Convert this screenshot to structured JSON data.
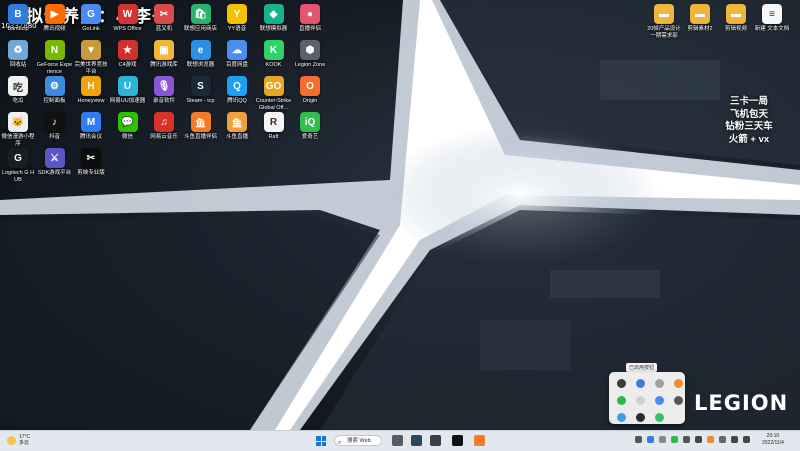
{
  "overlay": {
    "title": "模拟饲养员：小李子",
    "id": "10337880"
  },
  "desktop_icons": [
    {
      "key": "bandizip",
      "label": "Bandizip",
      "glyph": "B",
      "color": "#2d7ee0"
    },
    {
      "key": "tencent-video",
      "label": "腾讯视频",
      "glyph": "▶",
      "color": "#ff6a00"
    },
    {
      "key": "gocamp",
      "label": "GoLink",
      "glyph": "G",
      "color": "#4a8af5"
    },
    {
      "key": "wps",
      "label": "WPS Office",
      "glyph": "W",
      "color": "#d6322f"
    },
    {
      "key": "game-manager",
      "label": "蓝叉机",
      "glyph": "✂",
      "color": "#d94a4a"
    },
    {
      "key": "app-store",
      "label": "联想应用商店",
      "glyph": "🛍",
      "color": "#2ab36a"
    },
    {
      "key": "yy",
      "label": "YY语音",
      "glyph": "Y",
      "color": "#f6c200"
    },
    {
      "key": "emu",
      "label": "联想模拟器",
      "glyph": "◆",
      "color": "#18b28d"
    },
    {
      "key": "live",
      "label": "直播伴侣",
      "glyph": "●",
      "color": "#e4566f"
    },
    {
      "key": "recycle",
      "label": "回收站",
      "glyph": "♻",
      "color": "#6fa7d8"
    },
    {
      "key": "geforce",
      "label": "GeForce Experience",
      "glyph": "N",
      "color": "#76b900"
    },
    {
      "key": "tencent-game",
      "label": "完美世界竞技平台",
      "glyph": "▼",
      "color": "#c89a3a"
    },
    {
      "key": "games",
      "label": "C4游戏",
      "glyph": "★",
      "color": "#d1312d"
    },
    {
      "key": "tencent-gamebox",
      "label": "腾讯游戏库",
      "glyph": "▣",
      "color": "#f2b738"
    },
    {
      "key": "browser",
      "label": "联想浏览器",
      "glyph": "e",
      "color": "#2b8fe6"
    },
    {
      "key": "baidu-netdisk",
      "label": "百度网盘",
      "glyph": "☁",
      "color": "#4c8ef0"
    },
    {
      "key": "kook",
      "label": "KOOK",
      "glyph": "K",
      "color": "#2ed36a"
    },
    {
      "key": "legion",
      "label": "Legion Zone",
      "glyph": "⬢",
      "color": "#5b5f6e"
    },
    {
      "key": "pindao",
      "label": "吃瓜",
      "glyph": "吃",
      "color": "#f2f2f2"
    },
    {
      "key": "control",
      "label": "控制面板",
      "glyph": "⚙",
      "color": "#3d8be0"
    },
    {
      "key": "honeyview",
      "label": "Honeyview",
      "glyph": "H",
      "color": "#f2a20a"
    },
    {
      "key": "netease-accel",
      "label": "网易UU加速器",
      "glyph": "U",
      "color": "#2bb5d8"
    },
    {
      "key": "voice",
      "label": "录音软件",
      "glyph": "🎙",
      "color": "#8a55d6"
    },
    {
      "key": "steam",
      "label": "Steam - tcp",
      "glyph": "S",
      "color": "#1b2838"
    },
    {
      "key": "qq",
      "label": "腾讯QQ",
      "glyph": "Q",
      "color": "#1ba0f2"
    },
    {
      "key": "csgo",
      "label": "Counter-Strike Global Off...",
      "glyph": "GO",
      "color": "#e8a423"
    },
    {
      "key": "origin",
      "label": "Origin",
      "glyph": "O",
      "color": "#f56c2d"
    },
    {
      "key": "wechat-store",
      "label": "微信漫游小程序",
      "glyph": "🐱",
      "color": "#f0f0f0"
    },
    {
      "key": "tiktok",
      "label": "抖音",
      "glyph": "♪",
      "color": "#111111"
    },
    {
      "key": "feishu",
      "label": "腾讯会议",
      "glyph": "M",
      "color": "#2e7df5"
    },
    {
      "key": "wechat",
      "label": "微信",
      "glyph": "💬",
      "color": "#2dc100"
    },
    {
      "key": "netease-music",
      "label": "网易云音乐",
      "glyph": "♫",
      "color": "#d9312a"
    },
    {
      "key": "douyu",
      "label": "斗鱼直播伴侣",
      "glyph": "鱼",
      "color": "#f47b29"
    },
    {
      "key": "douyu2",
      "label": "斗鱼直播",
      "glyph": "鱼",
      "color": "#f0a03c"
    },
    {
      "key": "raft",
      "label": "Raft",
      "glyph": "R",
      "color": "#f5f5f5"
    },
    {
      "key": "iqiyi",
      "label": "爱奇艺",
      "glyph": "iQ",
      "color": "#2fbf4a"
    },
    {
      "key": "logitech",
      "label": "Logitech G HUB",
      "glyph": "G",
      "color": "#1d1d1d"
    },
    {
      "key": "sdk",
      "label": "SDK游戏平台",
      "glyph": "⚔",
      "color": "#5b56c8"
    },
    {
      "key": "capcut",
      "label": "剪映专业版",
      "glyph": "✂",
      "color": "#0c0c0c"
    }
  ],
  "desktop_folders": [
    {
      "key": "folder-1",
      "label": "20帧产品设计一期需求部",
      "glyph": "▬",
      "color": "#f0b63c"
    },
    {
      "key": "folder-2",
      "label": "剪辑素材2",
      "glyph": "▬",
      "color": "#f0b63c"
    },
    {
      "key": "folder-3",
      "label": "剪辑视频",
      "glyph": "▬",
      "color": "#f0b63c"
    },
    {
      "key": "text-doc",
      "label": "新建 文本文档",
      "glyph": "≡",
      "color": "#f7f7f7"
    }
  ],
  "promo_lines": [
    "三卡一局",
    "飞机包天",
    "钻粉三天车",
    "火箭 + vx"
  ],
  "brand_logo": "LEGION",
  "tray_popup_label": "已启用按钮",
  "taskbar": {
    "weather_temp": "17°C",
    "weather_desc": "多云",
    "search_placeholder": "搜索 Web",
    "clock_time": "20:10",
    "clock_date": "2022/11/4"
  }
}
